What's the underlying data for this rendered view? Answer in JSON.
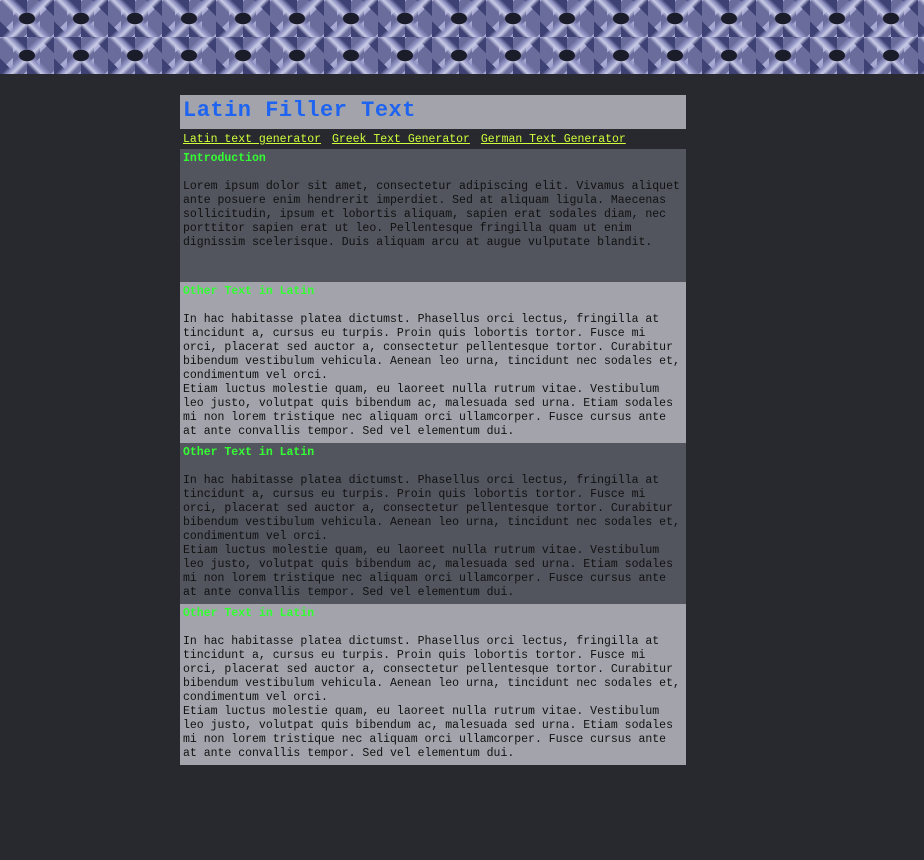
{
  "site": {
    "title": "Latin Filler Text"
  },
  "nav": {
    "links": [
      {
        "label": "Latin text generator"
      },
      {
        "label": "Greek Text Generator"
      },
      {
        "label": "German Text Generator"
      }
    ]
  },
  "sections": [
    {
      "heading": "Introduction",
      "paragraphs": [
        "Lorem ipsum dolor sit amet, consectetur adipiscing elit. Vivamus aliquet ante posuere enim hendrerit imperdiet. Sed at aliquam ligula. Maecenas sollicitudin, ipsum et lobortis aliquam, sapien erat sodales diam, nec porttitor sapien erat ut leo. Pellentesque fringilla quam ut enim dignissim scelerisque. Duis aliquam arcu at augue vulputate blandit."
      ]
    },
    {
      "heading": "Other Text in Latin",
      "paragraphs": [
        "In hac habitasse platea dictumst. Phasellus orci lectus, fringilla at tincidunt a, cursus eu turpis. Proin quis lobortis tortor. Fusce mi orci, placerat sed auctor a, consectetur pellentesque tortor. Curabitur bibendum vestibulum vehicula. Aenean leo urna, tincidunt nec sodales et, condimentum vel orci.",
        "Etiam luctus molestie quam, eu laoreet nulla rutrum vitae. Vestibulum leo justo, volutpat quis bibendum ac, malesuada sed urna. Etiam sodales mi non lorem tristique nec aliquam orci ullamcorper. Fusce cursus ante at ante convallis tempor. Sed vel elementum dui."
      ]
    },
    {
      "heading": "Other Text in Latin",
      "paragraphs": [
        "In hac habitasse platea dictumst. Phasellus orci lectus, fringilla at tincidunt a, cursus eu turpis. Proin quis lobortis tortor. Fusce mi orci, placerat sed auctor a, consectetur pellentesque tortor. Curabitur bibendum vestibulum vehicula. Aenean leo urna, tincidunt nec sodales et, condimentum vel orci.",
        "Etiam luctus molestie quam, eu laoreet nulla rutrum vitae. Vestibulum leo justo, volutpat quis bibendum ac, malesuada sed urna. Etiam sodales mi non lorem tristique nec aliquam orci ullamcorper. Fusce cursus ante at ante convallis tempor. Sed vel elementum dui."
      ]
    },
    {
      "heading": "Other Text in Latin",
      "paragraphs": [
        "In hac habitasse platea dictumst. Phasellus orci lectus, fringilla at tincidunt a, cursus eu turpis. Proin quis lobortis tortor. Fusce mi orci, placerat sed auctor a, consectetur pellentesque tortor. Curabitur bibendum vestibulum vehicula. Aenean leo urna, tincidunt nec sodales et, condimentum vel orci.",
        "Etiam luctus molestie quam, eu laoreet nulla rutrum vitae. Vestibulum leo justo, volutpat quis bibendum ac, malesuada sed urna. Etiam sodales mi non lorem tristique nec aliquam orci ullamcorper. Fusce cursus ante at ante convallis tempor. Sed vel elementum dui."
      ]
    }
  ],
  "colors": {
    "page_background": "#28292e",
    "title_color": "#1e64f0",
    "nav_link_color": "#cfff3c",
    "heading_color": "#33ff33",
    "section_dark": "#52545e",
    "section_light": "#a2a3ab"
  }
}
